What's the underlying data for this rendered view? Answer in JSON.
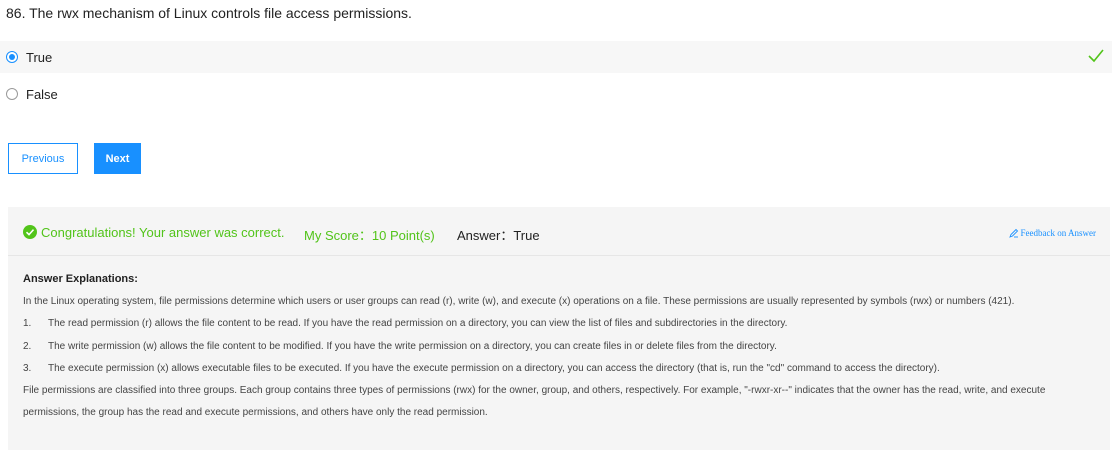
{
  "question": {
    "title": "86. The rwx mechanism of Linux controls file access permissions."
  },
  "options": [
    {
      "label": "True",
      "selected": true
    },
    {
      "label": "False",
      "selected": false
    }
  ],
  "buttons": {
    "previous": "Previous",
    "next": "Next"
  },
  "result": {
    "congrats": "Congratulations! Your answer was correct.",
    "score": "My Score：10 Point(s)",
    "answer": "Answer：True",
    "feedback": "Feedback on Answer"
  },
  "explanation": {
    "title": "Answer Explanations:",
    "intro": "In the Linux operating system, file permissions determine which users or user groups can read (r), write (w), and execute (x) operations on a file. These permissions are usually represented by symbols (rwx) or numbers (421).",
    "items": [
      {
        "num": "1.",
        "text": "The read permission (r) allows the file content to be read. If you have the read permission on a directory, you can view the list of files and subdirectories in the directory."
      },
      {
        "num": "2.",
        "text": "The write permission (w) allows the file content to be modified. If you have the write permission on a directory, you can create files in or delete files from the directory."
      },
      {
        "num": "3.",
        "text": "The execute permission (x) allows executable files to be executed. If you have the execute permission on a directory, you can access the directory (that is, run the \"cd\" command to access the directory)."
      }
    ],
    "outro": "File permissions are classified into three groups. Each group contains three types of permissions (rwx) for the owner, group, and others, respectively. For example, \"-rwxr-xr--\" indicates that the owner has the read, write, and execute permissions, the group has the read and execute permissions, and others have only the read permission."
  },
  "colors": {
    "accent": "#1890ff",
    "success": "#52c41a"
  },
  "icons": {
    "correct": "check-icon",
    "success": "check-circle-icon",
    "feedback": "edit-icon"
  }
}
